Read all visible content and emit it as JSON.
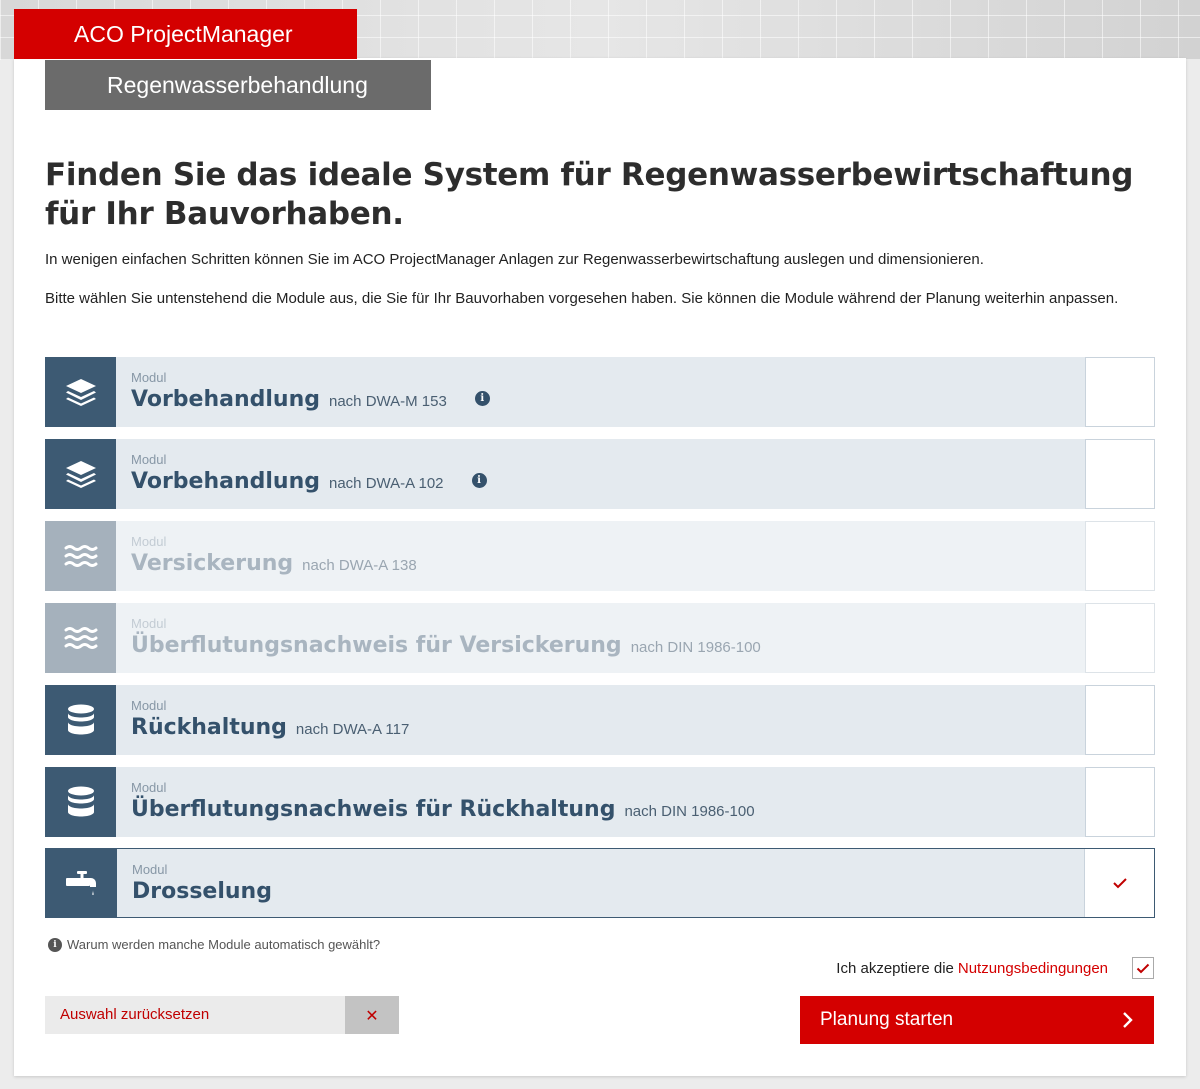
{
  "brand": {
    "title": "ACO ProjectManager"
  },
  "section_tab": {
    "label": "Regenwasserbehandlung"
  },
  "headline": "Finden Sie das ideale System für Regenwasserbewirtschaftung für Ihr Bauvorhaben.",
  "intro": {
    "p1": "In wenigen einfachen Schritten können Sie im ACO ProjectManager Anlagen zur Regenwasserbewirtschaftung auslegen und dimensionieren.",
    "p2": "Bitte wählen Sie untenstehend die Module aus, die Sie für Ihr Bauvorhaben vorgesehen haben. Sie können die Module während der Planung weiterhin anpassen."
  },
  "modules": [
    {
      "kicker": "Modul",
      "title": "Vorbehandlung",
      "norm": "nach DWA-M 153",
      "icon": "layers-icon",
      "info": "i",
      "state": "enabled",
      "checked": false
    },
    {
      "kicker": "Modul",
      "title": "Vorbehandlung",
      "norm": "nach DWA-A 102",
      "icon": "layers-icon",
      "info": "i",
      "state": "enabled",
      "checked": false
    },
    {
      "kicker": "Modul",
      "title": "Versickerung",
      "norm": "nach DWA-A 138",
      "icon": "water-waves-icon",
      "state": "disabled",
      "checked": false
    },
    {
      "kicker": "Modul",
      "title": "Überflutungsnachweis für Versickerung",
      "norm": "nach DIN 1986-100",
      "icon": "water-waves-icon",
      "state": "disabled",
      "checked": false
    },
    {
      "kicker": "Modul",
      "title": "Rückhaltung",
      "norm": "nach DWA-A 117",
      "icon": "database-icon",
      "state": "enabled",
      "checked": false
    },
    {
      "kicker": "Modul",
      "title": "Überflutungsnachweis für Rückhaltung",
      "norm": "nach DIN 1986-100",
      "icon": "database-icon",
      "state": "enabled",
      "checked": false
    },
    {
      "kicker": "Modul",
      "title": "Drosselung",
      "norm": "",
      "icon": "faucet-icon",
      "state": "selected",
      "checked": true
    }
  ],
  "help": {
    "text": "Warum werden manche Module automatisch gewählt?",
    "icon": "info-circle-icon"
  },
  "terms": {
    "prefix": "Ich akzeptiere die",
    "link": "Nutzungsbedingungen",
    "checked": true
  },
  "reset": {
    "label": "Auswahl zurücksetzen",
    "icon": "close-icon"
  },
  "start": {
    "label": "Planung starten",
    "icon": "chevron-right-icon"
  },
  "colors": {
    "brand_red": "#d40000",
    "module_blue": "#3d5a73",
    "module_bg": "#e4eaef",
    "disabled_icon_bg": "#a5b1bc"
  }
}
